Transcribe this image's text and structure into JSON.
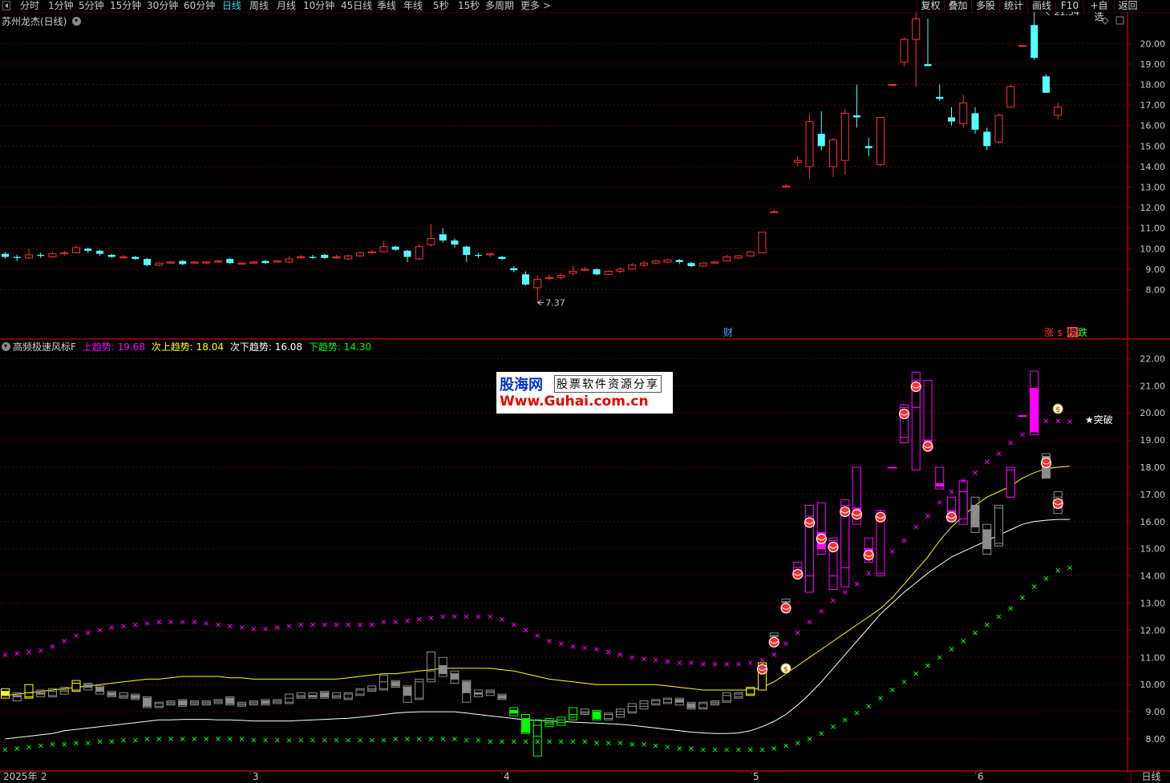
{
  "toolbar": {
    "periods": [
      "分时",
      "1分钟",
      "5分钟",
      "15分钟",
      "30分钟",
      "60分钟",
      "日线",
      "周线",
      "月线",
      "10分钟",
      "45日线",
      "季线",
      "年线",
      "5秒",
      "15秒",
      "多周期",
      "更多 >"
    ],
    "active_period": "日线",
    "right_buttons": [
      "复权",
      "叠加",
      "多股",
      "统计",
      "画线",
      "F10",
      "+自选",
      "返回"
    ]
  },
  "main_chart": {
    "title": "苏州龙杰(日线)",
    "high_label": "21.54",
    "low_label": "7.37",
    "y_ticks": [
      "20.00",
      "19.00",
      "18.00",
      "17.00",
      "16.00",
      "15.00",
      "14.00",
      "13.00",
      "12.00",
      "11.00",
      "10.00",
      "9.00",
      "8.00"
    ],
    "cai_label": "财",
    "zhang_label": "涨",
    "bang_label": "榜",
    "die_label": "跌",
    "chart_data": {
      "type": "candlestick",
      "ylim": [
        7.0,
        22.0
      ],
      "candles": [
        [
          9.75,
          9.6,
          9.85,
          9.5
        ],
        [
          9.6,
          9.55,
          9.7,
          9.4
        ],
        [
          9.55,
          9.7,
          10.0,
          9.5
        ],
        [
          9.7,
          9.65,
          9.8,
          9.55
        ],
        [
          9.6,
          9.75,
          9.85,
          9.55
        ],
        [
          9.75,
          9.8,
          9.9,
          9.65
        ],
        [
          9.8,
          10.05,
          10.15,
          9.75
        ],
        [
          10.0,
          9.9,
          10.05,
          9.8
        ],
        [
          9.9,
          9.75,
          9.95,
          9.65
        ],
        [
          9.7,
          9.6,
          9.75,
          9.55
        ],
        [
          9.55,
          9.6,
          9.7,
          9.5
        ],
        [
          9.6,
          9.5,
          9.65,
          9.45
        ],
        [
          9.5,
          9.2,
          9.55,
          9.15
        ],
        [
          9.2,
          9.3,
          9.35,
          9.15
        ],
        [
          9.3,
          9.35,
          9.4,
          9.25
        ],
        [
          9.4,
          9.25,
          9.45,
          9.2
        ],
        [
          9.3,
          9.35,
          9.4,
          9.25
        ],
        [
          9.3,
          9.35,
          9.4,
          9.25
        ],
        [
          9.35,
          9.4,
          9.45,
          9.3
        ],
        [
          9.5,
          9.3,
          9.55,
          9.25
        ],
        [
          9.25,
          9.3,
          9.35,
          9.2
        ],
        [
          9.3,
          9.35,
          9.4,
          9.25
        ],
        [
          9.4,
          9.3,
          9.45,
          9.25
        ],
        [
          9.35,
          9.4,
          9.45,
          9.3
        ],
        [
          9.35,
          9.5,
          9.65,
          9.3
        ],
        [
          9.55,
          9.6,
          9.7,
          9.5
        ],
        [
          9.6,
          9.55,
          9.7,
          9.5
        ],
        [
          9.7,
          9.55,
          9.75,
          9.5
        ],
        [
          9.55,
          9.6,
          9.7,
          9.5
        ],
        [
          9.5,
          9.65,
          9.7,
          9.45
        ],
        [
          9.65,
          9.8,
          9.85,
          9.6
        ],
        [
          9.8,
          9.85,
          9.95,
          9.75
        ],
        [
          9.85,
          10.1,
          10.35,
          9.8
        ],
        [
          10.1,
          9.95,
          10.15,
          9.9
        ],
        [
          9.9,
          9.6,
          9.95,
          9.35
        ],
        [
          9.5,
          10.1,
          10.2,
          9.45
        ],
        [
          10.2,
          10.5,
          11.2,
          10.1
        ],
        [
          10.7,
          10.4,
          11.0,
          10.3
        ],
        [
          10.4,
          10.2,
          10.5,
          10.05
        ],
        [
          10.1,
          9.7,
          10.15,
          9.35
        ],
        [
          9.7,
          9.65,
          9.8,
          9.55
        ],
        [
          9.7,
          9.75,
          9.8,
          9.6
        ],
        [
          9.6,
          9.5,
          9.65,
          9.45
        ],
        [
          9.05,
          8.95,
          9.15,
          8.85
        ],
        [
          8.75,
          8.25,
          8.9,
          8.2
        ],
        [
          8.1,
          8.5,
          8.7,
          7.37
        ],
        [
          8.55,
          8.6,
          8.75,
          8.45
        ],
        [
          8.6,
          8.7,
          8.8,
          8.5
        ],
        [
          8.8,
          8.9,
          9.15,
          8.7
        ],
        [
          8.95,
          9.0,
          9.1,
          8.9
        ],
        [
          9.0,
          8.75,
          9.05,
          8.7
        ],
        [
          8.75,
          8.9,
          8.95,
          8.7
        ],
        [
          8.9,
          9.0,
          9.1,
          8.8
        ],
        [
          9.0,
          9.2,
          9.3,
          8.95
        ],
        [
          9.2,
          9.3,
          9.4,
          9.1
        ],
        [
          9.3,
          9.4,
          9.45,
          9.25
        ],
        [
          9.35,
          9.45,
          9.5,
          9.3
        ],
        [
          9.45,
          9.35,
          9.5,
          9.25
        ],
        [
          9.3,
          9.15,
          9.35,
          9.1
        ],
        [
          9.15,
          9.3,
          9.35,
          9.1
        ],
        [
          9.3,
          9.35,
          9.4,
          9.25
        ],
        [
          9.4,
          9.6,
          9.7,
          9.35
        ],
        [
          9.55,
          9.65,
          9.7,
          9.5
        ],
        [
          9.65,
          9.85,
          9.9,
          9.6
        ],
        [
          9.8,
          10.8,
          10.8,
          9.8
        ],
        [
          11.8,
          11.8,
          11.9,
          11.8
        ],
        [
          13.05,
          13.05,
          13.15,
          13.05
        ],
        [
          14.2,
          14.3,
          14.5,
          14.0
        ],
        [
          14.0,
          16.2,
          16.6,
          13.4
        ],
        [
          15.6,
          15.0,
          16.7,
          14.8
        ],
        [
          14.0,
          15.3,
          15.4,
          13.5
        ],
        [
          14.3,
          16.6,
          16.8,
          13.6
        ],
        [
          16.5,
          16.4,
          18.0,
          15.9
        ],
        [
          15.0,
          14.9,
          15.4,
          14.5
        ],
        [
          14.1,
          16.4,
          16.4,
          14.0
        ],
        [
          18.0,
          18.0,
          18.0,
          18.0
        ],
        [
          19.1,
          20.2,
          20.3,
          18.9
        ],
        [
          20.2,
          21.2,
          21.5,
          17.9
        ],
        [
          19.0,
          18.9,
          21.2,
          18.9
        ],
        [
          17.4,
          17.3,
          18.0,
          17.2
        ],
        [
          16.4,
          16.2,
          16.9,
          16.0
        ],
        [
          16.1,
          17.1,
          17.5,
          15.9
        ],
        [
          16.6,
          15.8,
          16.9,
          15.6
        ],
        [
          15.7,
          15.0,
          15.9,
          14.8
        ],
        [
          15.2,
          16.5,
          16.6,
          15.1
        ],
        [
          16.9,
          17.9,
          18.0,
          16.9
        ],
        [
          19.9,
          19.9,
          19.9,
          19.9
        ],
        [
          20.9,
          19.3,
          21.54,
          19.2
        ],
        [
          18.4,
          17.6,
          18.5,
          17.6
        ],
        [
          16.5,
          16.9,
          17.1,
          16.3
        ]
      ]
    }
  },
  "indicator": {
    "name": "高频极速风标F",
    "up_label": "上趋势: ",
    "up_value": "19.68",
    "sub_up_label": "次上趋势: ",
    "sub_up_value": "18.04",
    "sub_down_label": "次下趋势: ",
    "sub_down_value": "16.08",
    "down_label": "下趋势: ",
    "down_value": "14.30",
    "y_ticks": [
      "22.00",
      "21.00",
      "20.00",
      "19.00",
      "18.00",
      "17.00",
      "16.00",
      "15.00",
      "14.00",
      "13.00",
      "12.00",
      "11.00",
      "10.00",
      "9.00",
      "8.00"
    ],
    "tupo_label": "★突破",
    "colors": {
      "up": "#ff00ff",
      "sub_up": "#ffff00",
      "sub_down": "#ffffff",
      "down": "#00ff00"
    },
    "chart_data": {
      "type": "line",
      "ylim": [
        7.5,
        22.5
      ],
      "series": [
        {
          "name": "上趋势",
          "values": [
            11.1,
            11.15,
            11.2,
            11.25,
            11.4,
            11.6,
            11.8,
            11.9,
            12.0,
            12.1,
            12.15,
            12.2,
            12.25,
            12.3,
            12.3,
            12.3,
            12.3,
            12.25,
            12.2,
            12.15,
            12.1,
            12.05,
            12.05,
            12.1,
            12.15,
            12.2,
            12.2,
            12.2,
            12.2,
            12.2,
            12.2,
            12.2,
            12.3,
            12.3,
            12.35,
            12.4,
            12.45,
            12.5,
            12.5,
            12.5,
            12.5,
            12.5,
            12.4,
            12.2,
            12.0,
            11.8,
            11.6,
            11.5,
            11.4,
            11.35,
            11.3,
            11.2,
            11.1,
            11.0,
            10.95,
            10.9,
            10.85,
            10.8,
            10.8,
            10.75,
            10.75,
            10.75,
            10.75,
            10.8,
            10.9,
            11.1,
            11.5,
            11.9,
            12.3,
            12.7,
            13.1,
            13.4,
            13.7,
            14.1,
            14.5,
            14.9,
            15.3,
            15.8,
            16.2,
            16.7,
            17.1,
            17.5,
            17.8,
            18.2,
            18.5,
            18.9,
            19.2,
            19.5,
            19.7,
            19.7,
            19.68
          ]
        },
        {
          "name": "次上趋势",
          "values": [
            9.6,
            9.65,
            9.7,
            9.75,
            9.8,
            9.85,
            9.9,
            9.95,
            10.0,
            10.05,
            10.1,
            10.15,
            10.2,
            10.2,
            10.25,
            10.3,
            10.3,
            10.3,
            10.3,
            10.25,
            10.25,
            10.2,
            10.2,
            10.2,
            10.2,
            10.2,
            10.2,
            10.2,
            10.2,
            10.25,
            10.3,
            10.35,
            10.4,
            10.4,
            10.45,
            10.5,
            10.55,
            10.6,
            10.6,
            10.6,
            10.6,
            10.6,
            10.55,
            10.5,
            10.4,
            10.3,
            10.2,
            10.15,
            10.1,
            10.05,
            10.0,
            10.0,
            10.0,
            10.0,
            10.0,
            10.0,
            9.95,
            9.9,
            9.85,
            9.8,
            9.8,
            9.8,
            9.8,
            9.8,
            9.9,
            10.1,
            10.4,
            10.7,
            11.0,
            11.3,
            11.6,
            11.9,
            12.2,
            12.5,
            12.8,
            13.2,
            13.7,
            14.2,
            14.7,
            15.3,
            15.8,
            16.2,
            16.6,
            16.9,
            17.1,
            17.3,
            17.6,
            17.8,
            17.95,
            18.0,
            18.04
          ]
        },
        {
          "name": "次下趋势",
          "values": [
            8.0,
            8.05,
            8.1,
            8.15,
            8.2,
            8.3,
            8.35,
            8.4,
            8.45,
            8.5,
            8.55,
            8.6,
            8.65,
            8.7,
            8.7,
            8.72,
            8.72,
            8.72,
            8.7,
            8.7,
            8.68,
            8.66,
            8.66,
            8.66,
            8.66,
            8.68,
            8.7,
            8.72,
            8.74,
            8.76,
            8.8,
            8.85,
            8.9,
            8.95,
            8.98,
            9.0,
            9.0,
            9.0,
            9.0,
            8.95,
            8.9,
            8.85,
            8.8,
            8.75,
            8.7,
            8.68,
            8.66,
            8.64,
            8.62,
            8.6,
            8.58,
            8.56,
            8.54,
            8.5,
            8.45,
            8.4,
            8.35,
            8.3,
            8.25,
            8.22,
            8.2,
            8.2,
            8.22,
            8.3,
            8.45,
            8.65,
            8.9,
            9.25,
            9.65,
            10.1,
            10.6,
            11.1,
            11.6,
            12.1,
            12.6,
            13.0,
            13.4,
            13.75,
            14.1,
            14.4,
            14.7,
            14.9,
            15.1,
            15.3,
            15.5,
            15.7,
            15.9,
            16.0,
            16.05,
            16.08,
            16.08
          ]
        },
        {
          "name": "下趋势",
          "values": [
            7.6,
            7.65,
            7.7,
            7.75,
            7.8,
            7.8,
            7.85,
            7.85,
            7.9,
            7.9,
            7.95,
            7.95,
            8.0,
            8.0,
            8.0,
            8.0,
            8.0,
            8.0,
            8.0,
            8.0,
            8.0,
            7.95,
            7.95,
            7.95,
            7.95,
            7.95,
            7.95,
            7.95,
            7.95,
            7.95,
            7.95,
            7.95,
            7.95,
            8.0,
            8.0,
            8.0,
            8.0,
            8.0,
            8.0,
            7.95,
            7.95,
            7.9,
            7.9,
            7.9,
            7.9,
            7.9,
            7.9,
            7.9,
            7.9,
            7.9,
            7.85,
            7.85,
            7.85,
            7.8,
            7.8,
            7.75,
            7.7,
            7.65,
            7.65,
            7.6,
            7.6,
            7.6,
            7.6,
            7.6,
            7.6,
            7.65,
            7.75,
            7.85,
            8.0,
            8.2,
            8.45,
            8.7,
            8.95,
            9.2,
            9.5,
            9.8,
            10.1,
            10.4,
            10.7,
            11.0,
            11.3,
            11.6,
            11.9,
            12.2,
            12.5,
            12.8,
            13.2,
            13.6,
            13.9,
            14.2,
            14.3
          ]
        }
      ]
    }
  },
  "watermark": {
    "line1a": "股海网",
    "line1b": "股票软件资源分享",
    "line2": "Www.Guhai.com.cn"
  },
  "x_axis": {
    "labels": [
      "2025年",
      "2",
      "3",
      "4",
      "5",
      "6"
    ],
    "period_label": "日线"
  }
}
